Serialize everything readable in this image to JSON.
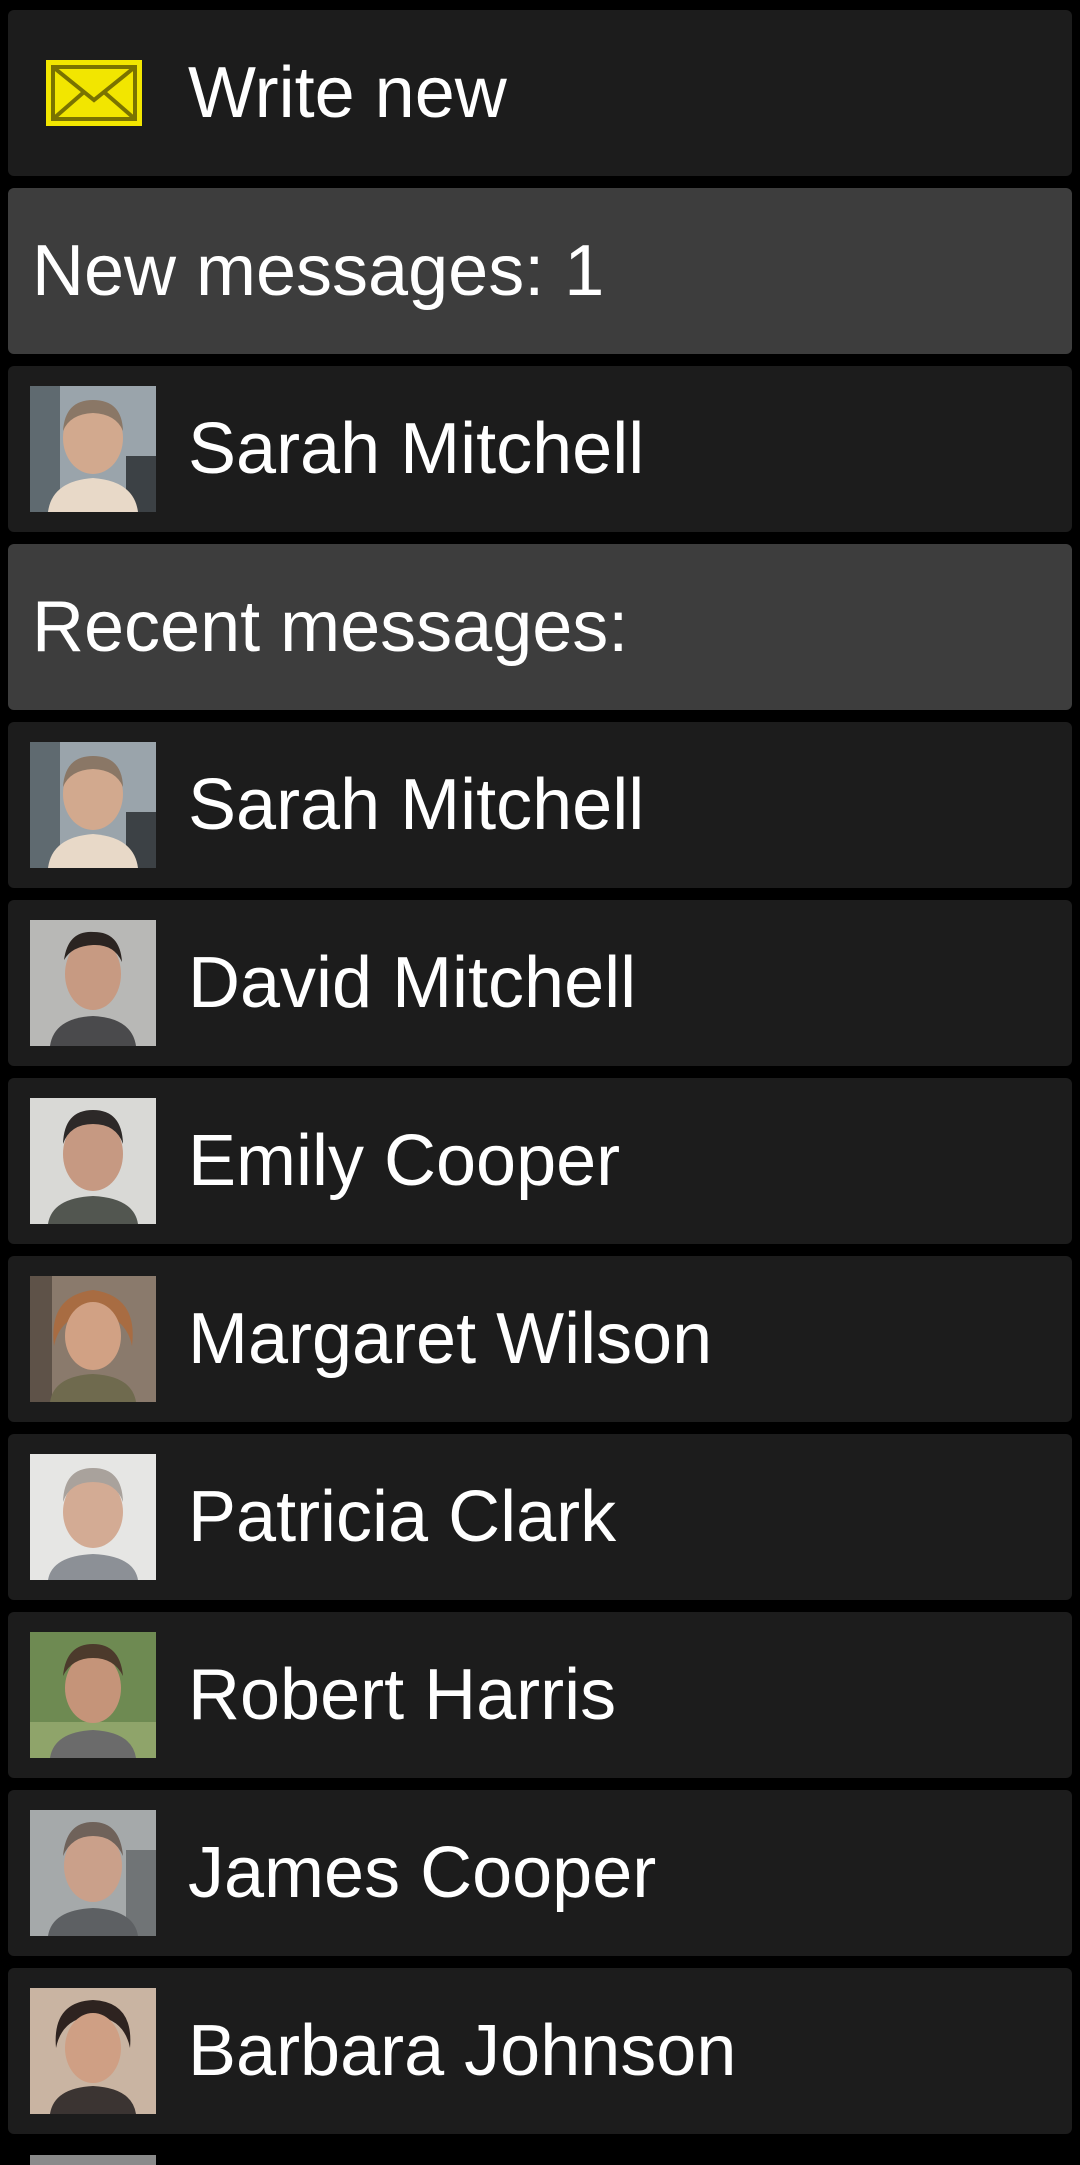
{
  "write_new": {
    "label": "Write new",
    "icon": "envelope-icon",
    "icon_color": "#f2e600"
  },
  "new_messages": {
    "header": "New messages: 1",
    "items": [
      {
        "name": "Sarah Mitchell",
        "avatar": "photo-sarah-mitchell"
      }
    ]
  },
  "recent_messages": {
    "header": "Recent messages:",
    "items": [
      {
        "name": "Sarah Mitchell",
        "avatar": "photo-sarah-mitchell"
      },
      {
        "name": "David Mitchell",
        "avatar": "photo-david-mitchell"
      },
      {
        "name": "Emily Cooper",
        "avatar": "photo-emily-cooper"
      },
      {
        "name": "Margaret Wilson",
        "avatar": "photo-margaret-wilson"
      },
      {
        "name": "Patricia Clark",
        "avatar": "photo-patricia-clark"
      },
      {
        "name": "Robert Harris",
        "avatar": "photo-robert-harris"
      },
      {
        "name": "James Cooper",
        "avatar": "photo-james-cooper"
      },
      {
        "name": "Barbara Johnson",
        "avatar": "photo-barbara-johnson"
      }
    ]
  },
  "colors": {
    "row_background": "#1c1c1c",
    "header_background": "#3d3d3d",
    "page_background": "#000000",
    "text": "#ffffff"
  }
}
